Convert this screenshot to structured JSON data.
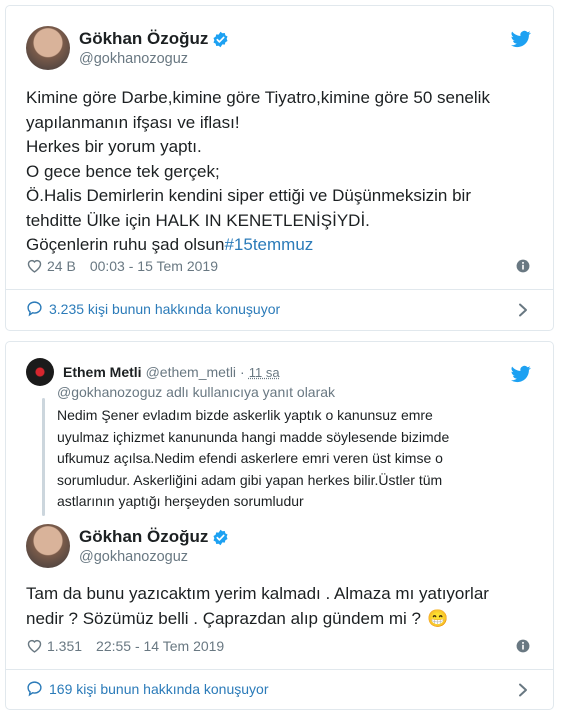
{
  "colors": {
    "link": "#2b7bb9",
    "twitter_blue": "#1da1f2",
    "muted": "#697882",
    "text": "#1c2022",
    "border": "#e1e8ed"
  },
  "tweet1": {
    "author": {
      "name": "Gökhan Özoğuz",
      "handle": "@gokhanozoguz",
      "verified": true
    },
    "text_lines": [
      "Kimine göre Darbe,kimine göre Tiyatro,kimine göre 50 senelik",
      "yapılanmanın ifşası ve iflası!",
      "Herkes bir yorum yaptı.",
      "O gece bence tek gerçek;",
      "Ö.Halis Demirlerin kendini siper ettiği ve Düşünmeksizin bir",
      "tehditte Ülke için HALK IN KENETLENİŞİYDİ.",
      "Göçenlerin ruhu şad olsun"
    ],
    "hashtag": "#15temmuz",
    "likes": "24 B",
    "timestamp": "00:03 - 15 Tem 2019",
    "conversation": "3.235 kişi bunun hakkında konuşuyor"
  },
  "tweet2": {
    "quoted": {
      "name": "Ethem Metli",
      "handle": "@ethem_metli",
      "separator": "·",
      "time": "11 sa",
      "reply_to": "@gokhanozoguz adlı kullanıcıya yanıt olarak",
      "text_lines": [
        "Nedim Şener evladım bizde askerlik yaptık o kanunsuz emre",
        "uyulmaz içhizmet kanununda hangi madde söylesende bizimde",
        "ufkumuz açılsa.Nedim efendi askerlere emri veren üst kimse o",
        "sorumludur. Askerliğini adam gibi yapan herkes bilir.Üstler tüm",
        "astlarının yaptığı herşeyden sorumludur"
      ]
    },
    "author": {
      "name": "Gökhan Özoğuz",
      "handle": "@gokhanozoguz",
      "verified": true
    },
    "text_lines": [
      "Tam da  bunu yazıcaktım yerim kalmadı . Almaza mı yatıyorlar",
      "nedir ? Sözümüz belli . Çaprazdan alıp gündem mi  ?"
    ],
    "emoji": "😁",
    "likes": "1.351",
    "timestamp": "22:55 - 14 Tem 2019",
    "conversation": "169 kişi bunun hakkında konuşuyor"
  }
}
